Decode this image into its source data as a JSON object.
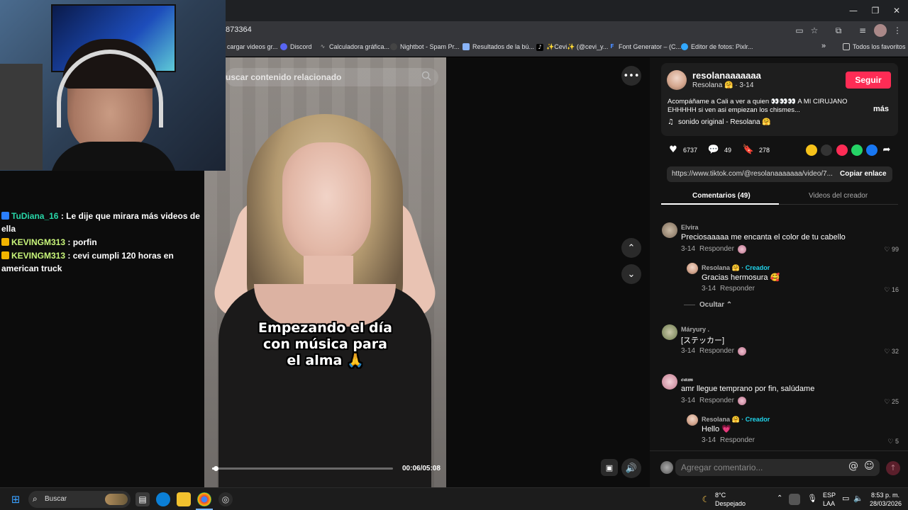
{
  "browser": {
    "url_fragment": "873364",
    "window_controls": {
      "minimize": "—",
      "restore": "❐",
      "close": "✕"
    },
    "bookmarks": [
      {
        "label": "cargar videos gr..."
      },
      {
        "label": "Discord"
      },
      {
        "label": "Calculadora gráfica..."
      },
      {
        "label": "Nightbot - Spam Pr..."
      },
      {
        "label": "Resultados de la bú..."
      },
      {
        "label": "✨Cevi✨ (@cevi_y..."
      },
      {
        "label": "Font Generator – (C..."
      },
      {
        "label": "Editor de fotos: Pixlr..."
      }
    ],
    "bookmarks_more": "»",
    "all_favorites": "Todos los favoritos"
  },
  "colors": {
    "accent": "#fe2c55",
    "creator": "#20d5ec",
    "chat_user_1": "#28d7a9",
    "chat_user_2": "#c8f57a"
  },
  "chat": [
    {
      "user": "TuDiana_16",
      "sep": ":",
      "message": "Le dije que mirara más videos de ella"
    },
    {
      "user": "KEVINGM313",
      "sep": ":",
      "message": "porfin"
    },
    {
      "user": "KEVINGM313",
      "sep": ":",
      "message": "cevi cumpli 120 horas en american truck"
    }
  ],
  "video": {
    "search_placeholder": "uscar contenido relacionado",
    "caption_lines": [
      "Empezando el día",
      "con música para",
      "el alma 🙏"
    ],
    "time": "00:06/05:08",
    "progress": 0.02,
    "more": "•••",
    "up": "⌃",
    "down": "⌄",
    "volume": "🔊"
  },
  "post": {
    "username": "resolanaaaaaaa",
    "nickname": "Resolana 🤗",
    "date": "· 3-14",
    "follow": "Seguir",
    "description_line1": "Acompáñame a Cali a ver a quien 👀👀👀 A MI CIRUJANO",
    "description_line2": "EHHHHH si ven asi empiezan los chismes...",
    "more": "más",
    "music": "sonido original - Resolana 🤗",
    "likes": "6737",
    "comments": "49",
    "saves": "278",
    "link": "https://www.tiktok.com/@resolanaaaaaaa/video/7...",
    "copy_link": "Copiar enlace",
    "tab_comments": "Comentarios (49)",
    "tab_videos": "Videos del creador"
  },
  "comments": [
    {
      "name": "Elvira",
      "text": "Preciosaaaaa me encanta el color de tu cabello",
      "date": "3-14",
      "reply": "Responder",
      "likes": "99"
    },
    {
      "name": "Resolana 🤗",
      "creator_tag": "· Creador",
      "text": "Gracias hermosura 🥰",
      "date": "3-14",
      "reply": "Responder",
      "likes": "16"
    },
    {
      "name": "Máryury .",
      "text": "[ステッカー]",
      "date": "3-14",
      "reply": "Responder",
      "likes": "32"
    },
    {
      "name": "𝓬𝓪𝓶",
      "text": "amr llegue temprano por fin, salúdame",
      "date": "3-14",
      "reply": "Responder",
      "likes": "25"
    },
    {
      "name": "Resolana 🤗",
      "creator_tag": "· Creador",
      "text": "Hello 💗",
      "date": "3-14",
      "reply": "Responder",
      "likes": "5"
    }
  ],
  "hide_replies": "Ocultar ⌃",
  "comment_input_placeholder": "Agregar comentario...",
  "taskbar": {
    "search": "Buscar",
    "weather_temp": "8°C",
    "weather_desc": "Despejado",
    "lang1": "ESP",
    "lang2": "LAA",
    "time": "8:53 p. m.",
    "date": "28/03/2026"
  }
}
